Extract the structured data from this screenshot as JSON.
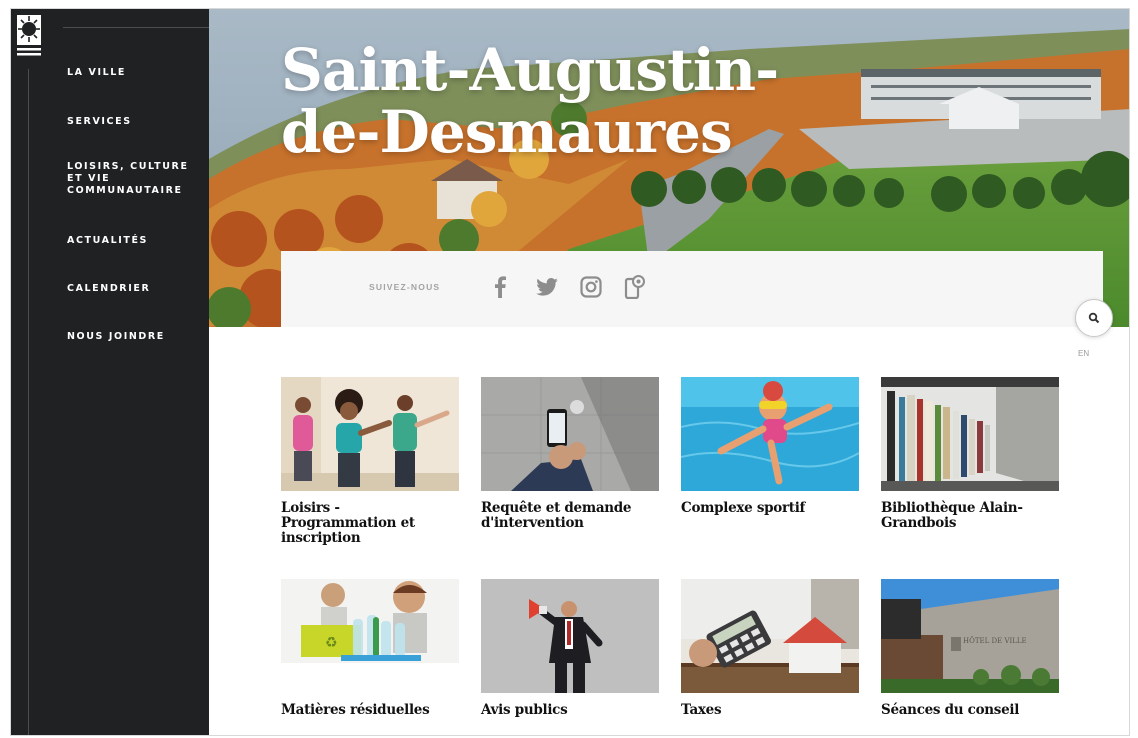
{
  "brand": {
    "title": "Saint-Augustin-de-Desmaures"
  },
  "nav": {
    "items": [
      {
        "label": "LA VILLE"
      },
      {
        "label": "SERVICES"
      },
      {
        "label": "LOISIRS, CULTURE ET VIE COMMUNAUTAIRE"
      },
      {
        "label": "ACTUALITÉS"
      },
      {
        "label": "CALENDRIER"
      },
      {
        "label": "NOUS JOINDRE"
      }
    ]
  },
  "hero": {
    "title_line1": "Saint-Augustin-",
    "title_line2": "de-Desmaures"
  },
  "social": {
    "label": "SUIVEZ-NOUS",
    "icons": [
      "facebook-icon",
      "twitter-icon",
      "instagram-icon",
      "citizen-app-icon"
    ]
  },
  "utility": {
    "search_icon": "search-icon",
    "language": "EN"
  },
  "tiles": [
    {
      "caption": "Loisirs - Programmation et inscription",
      "image": "fitness-class"
    },
    {
      "caption": "Requête et demande d'intervention",
      "image": "smartphone-hand"
    },
    {
      "caption": "Complexe sportif",
      "image": "child-swimming"
    },
    {
      "caption": "Bibliothèque Alain-Grandbois",
      "image": "library-shelves"
    },
    {
      "caption": "Matières résiduelles",
      "image": "recycling-kids"
    },
    {
      "caption": "Avis publics",
      "image": "megaphone-man"
    },
    {
      "caption": "Taxes",
      "image": "calculator-house"
    },
    {
      "caption": "Séances du conseil",
      "image": "city-hall"
    }
  ],
  "colors": {
    "sidebar": "#1f2123",
    "social_bar": "#f6f6f6",
    "icon_grey": "#8d8d8d"
  }
}
